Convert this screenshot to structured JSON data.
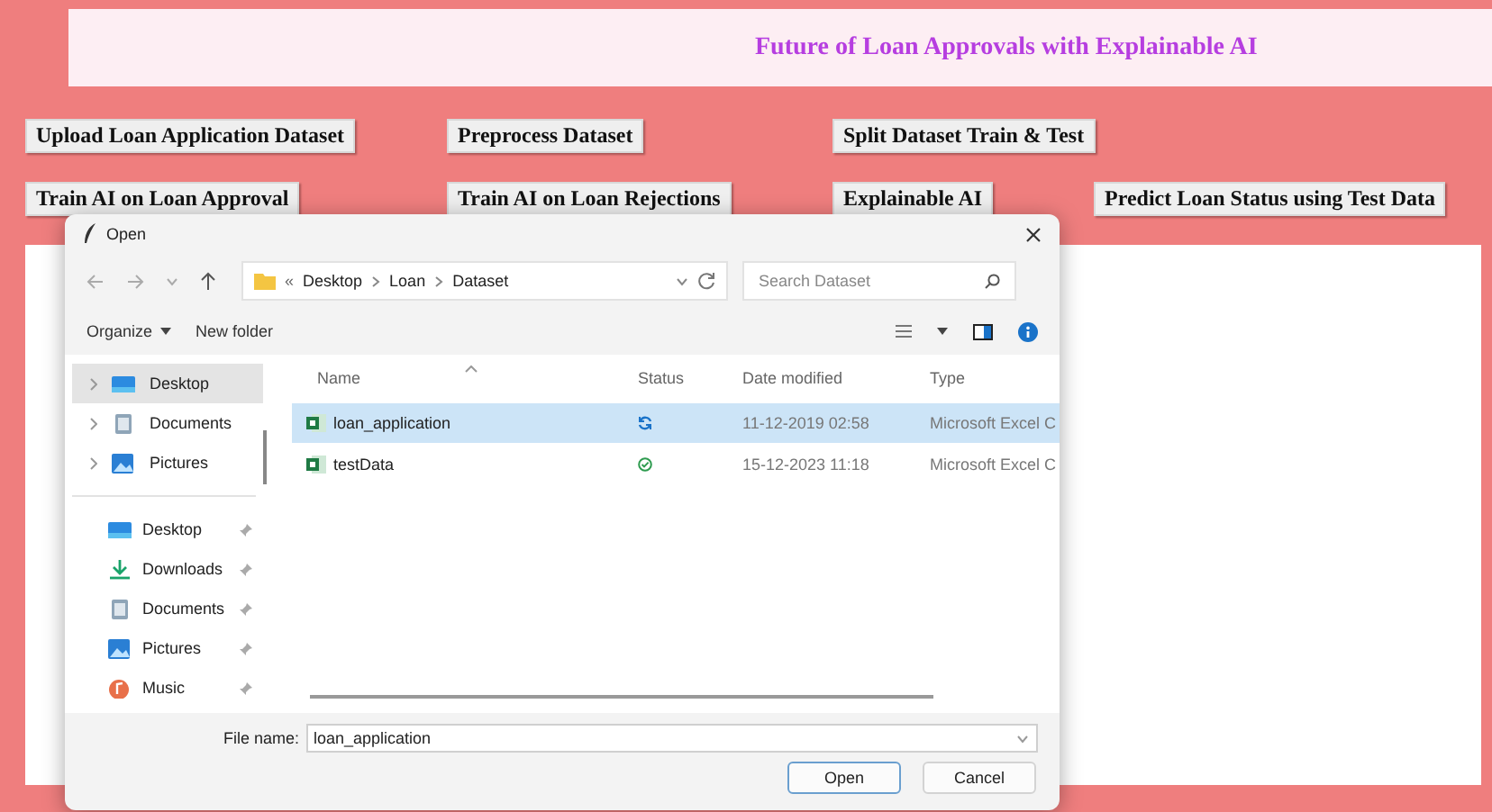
{
  "app": {
    "title": "Future of Loan Approvals with Explainable AI",
    "button_rows": [
      [
        "Upload Loan Application Dataset",
        "Preprocess Dataset",
        "Split Dataset Train & Test"
      ],
      [
        "Train AI on Loan Approval",
        "Train AI on Loan Rejections",
        "Explainable AI",
        "Predict Loan Status using Test Data"
      ]
    ]
  },
  "dialog": {
    "title": "Open",
    "address": [
      "Desktop",
      "Loan",
      "Dataset"
    ],
    "address_prefix": "«",
    "search": {
      "placeholder": "Search Dataset"
    },
    "toolbar": {
      "organize": "Organize",
      "new_folder": "New folder"
    },
    "nav": [
      {
        "kind": "tree",
        "label": "Desktop",
        "selected": true
      },
      {
        "kind": "tree",
        "label": "Documents",
        "selected": false
      },
      {
        "kind": "tree",
        "label": "Pictures",
        "selected": false
      },
      {
        "kind": "pinned",
        "label": "Desktop",
        "selected": false
      },
      {
        "kind": "pinned",
        "label": "Downloads",
        "selected": false
      },
      {
        "kind": "pinned",
        "label": "Documents",
        "selected": false
      },
      {
        "kind": "pinned",
        "label": "Pictures",
        "selected": false
      },
      {
        "kind": "pinned",
        "label": "Music",
        "selected": false
      }
    ],
    "columns": [
      "Name",
      "Status",
      "Date modified",
      "Type"
    ],
    "files": [
      {
        "name": "loan_application",
        "synced": false,
        "date": "11-12-2019 02:58",
        "type": "Microsoft Excel C",
        "selected": true
      },
      {
        "name": "testData",
        "synced": true,
        "date": "15-12-2023 11:18",
        "type": "Microsoft Excel C",
        "selected": false
      }
    ],
    "file_name_label": "File name:",
    "file_name": "loan_application",
    "buttons": [
      {
        "label": "Open",
        "default": true
      },
      {
        "label": "Cancel",
        "default": false
      }
    ]
  }
}
